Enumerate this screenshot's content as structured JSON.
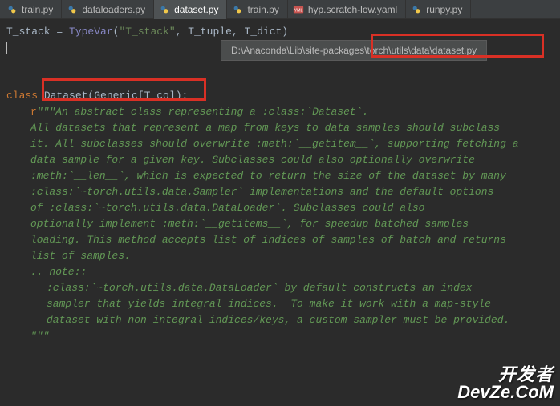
{
  "tabs": [
    {
      "label": "train.py",
      "partial": true
    },
    {
      "label": "dataloaders.py"
    },
    {
      "label": "dataset.py",
      "active": true
    },
    {
      "label": "train.py"
    },
    {
      "label": "hyp.scratch-low.yaml",
      "yaml": true
    },
    {
      "label": "runpy.py"
    }
  ],
  "tooltip_text": "D:\\Anaconda\\Lib\\site-packages\\torch\\utils\\data\\dataset.py",
  "code": {
    "line1_var": "T_stack",
    "line1_eq": " = ",
    "line1_typevar": "TypeVar",
    "line1_open": "(",
    "line1_str": "\"T_stack\"",
    "line1_comma": ", ",
    "line1_arg2": "T_tuple",
    "line1_comma2": ", ",
    "line1_arg3": "T_dict",
    "line1_close": ")",
    "class_kw": "class ",
    "class_name": "Dataset",
    "class_open": "(",
    "class_generic": "Generic",
    "class_bracket_open": "[",
    "class_tco": "T_co",
    "class_bracket_close": "]",
    "class_close": "):",
    "doc_prefix": "r",
    "doc_open": "\"\"\"An abstract class representing a :class:`Dataset`.",
    "doc_lines": [
      "",
      "All datasets that represent a map from keys to data samples should subclass",
      "it. All subclasses should overwrite :meth:`__getitem__`, supporting fetching a",
      "data sample for a given key. Subclasses could also optionally overwrite",
      ":meth:`__len__`, which is expected to return the size of the dataset by many",
      ":class:`~torch.utils.data.Sampler` implementations and the default options",
      "of :class:`~torch.utils.data.DataLoader`. Subclasses could also",
      "optionally implement :meth:`__getitems__`, for speedup batched samples",
      "loading. This method accepts list of indices of samples of batch and returns",
      "list of samples.",
      "",
      ".. note::"
    ],
    "doc_note_lines": [
      ":class:`~torch.utils.data.DataLoader` by default constructs an index",
      "sampler that yields integral indices.  To make it work with a map-style",
      "dataset with non-integral indices/keys, a custom sampler must be provided."
    ],
    "doc_close": "\"\"\""
  },
  "watermark": {
    "top": "开发者",
    "bottom": "DevZe.CoM"
  }
}
